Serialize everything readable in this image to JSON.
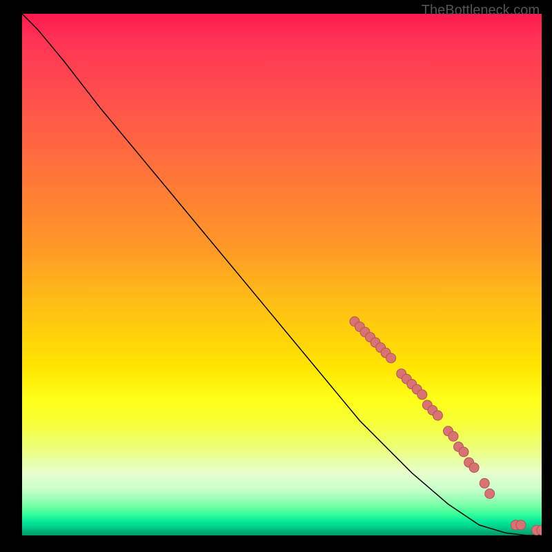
{
  "watermark": "TheBottleneck.com",
  "chart_data": {
    "type": "line",
    "title": "",
    "xlabel": "",
    "ylabel": "",
    "x_range": [
      0,
      100
    ],
    "y_range": [
      0,
      100
    ],
    "curve": [
      {
        "x": 0,
        "y": 100
      },
      {
        "x": 3,
        "y": 97
      },
      {
        "x": 8,
        "y": 91
      },
      {
        "x": 15,
        "y": 82
      },
      {
        "x": 25,
        "y": 70
      },
      {
        "x": 35,
        "y": 58
      },
      {
        "x": 45,
        "y": 46
      },
      {
        "x": 55,
        "y": 34
      },
      {
        "x": 65,
        "y": 22
      },
      {
        "x": 75,
        "y": 12
      },
      {
        "x": 82,
        "y": 6
      },
      {
        "x": 88,
        "y": 2
      },
      {
        "x": 93,
        "y": 0.5
      },
      {
        "x": 97,
        "y": 0
      },
      {
        "x": 100,
        "y": 0
      }
    ],
    "points": [
      {
        "x": 64,
        "y": 41
      },
      {
        "x": 65,
        "y": 40
      },
      {
        "x": 66,
        "y": 39
      },
      {
        "x": 67,
        "y": 38
      },
      {
        "x": 68,
        "y": 37
      },
      {
        "x": 69,
        "y": 36
      },
      {
        "x": 70,
        "y": 35
      },
      {
        "x": 71,
        "y": 34
      },
      {
        "x": 73,
        "y": 31
      },
      {
        "x": 74,
        "y": 30
      },
      {
        "x": 75,
        "y": 29
      },
      {
        "x": 76,
        "y": 28
      },
      {
        "x": 77,
        "y": 27
      },
      {
        "x": 78,
        "y": 25
      },
      {
        "x": 79,
        "y": 24
      },
      {
        "x": 80,
        "y": 23
      },
      {
        "x": 82,
        "y": 20
      },
      {
        "x": 83,
        "y": 19
      },
      {
        "x": 84,
        "y": 17
      },
      {
        "x": 85,
        "y": 16
      },
      {
        "x": 86,
        "y": 14
      },
      {
        "x": 87,
        "y": 13
      },
      {
        "x": 89,
        "y": 10
      },
      {
        "x": 90,
        "y": 8
      },
      {
        "x": 95,
        "y": 2
      },
      {
        "x": 96,
        "y": 2
      },
      {
        "x": 99,
        "y": 1
      },
      {
        "x": 100,
        "y": 1
      }
    ]
  }
}
